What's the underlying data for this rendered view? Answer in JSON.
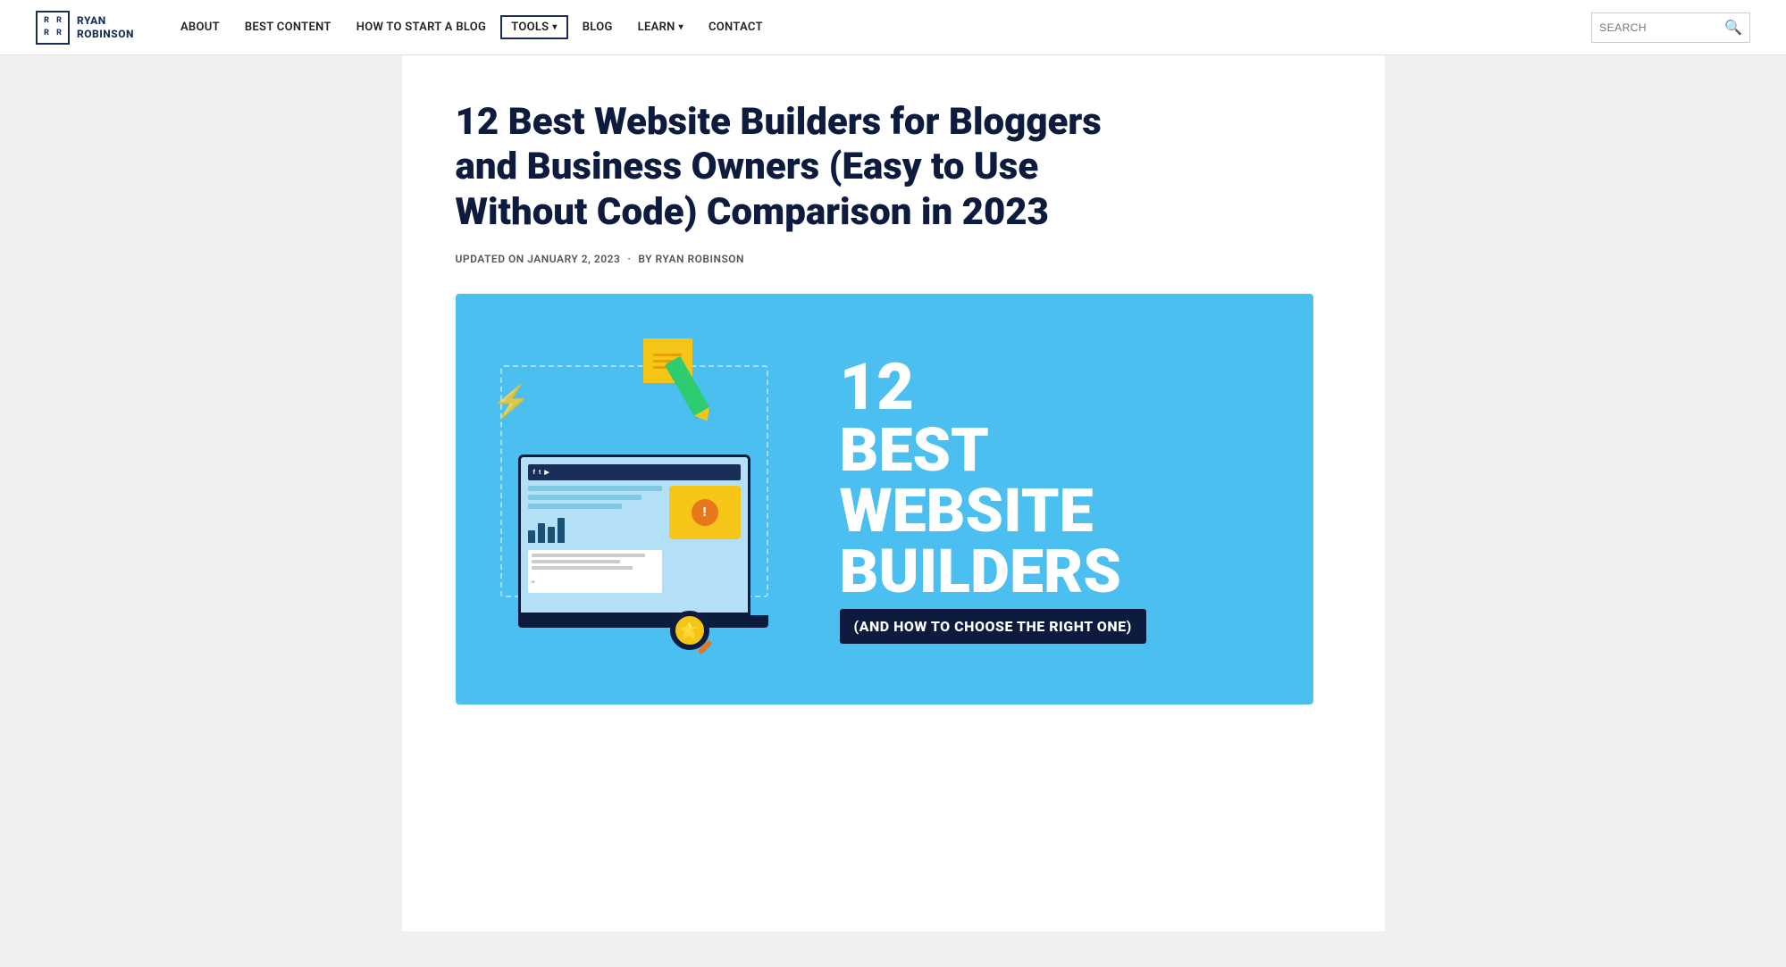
{
  "logo": {
    "line1": "RYAN",
    "line2": "ROBINSON",
    "letters": [
      "R",
      "R",
      "R",
      "R"
    ]
  },
  "nav": {
    "items": [
      {
        "id": "about",
        "label": "ABOUT",
        "active": false,
        "hasDropdown": false
      },
      {
        "id": "best-content",
        "label": "BEST CONTENT",
        "active": false,
        "hasDropdown": false
      },
      {
        "id": "how-to-start-a-blog",
        "label": "HOW TO START A BLOG",
        "active": false,
        "hasDropdown": false
      },
      {
        "id": "tools",
        "label": "TOOLS",
        "active": true,
        "hasDropdown": true
      },
      {
        "id": "blog",
        "label": "BLOG",
        "active": false,
        "hasDropdown": false
      },
      {
        "id": "learn",
        "label": "LEARN",
        "active": false,
        "hasDropdown": true
      },
      {
        "id": "contact",
        "label": "CONTACT",
        "active": false,
        "hasDropdown": false
      }
    ],
    "search_placeholder": "SEARCH"
  },
  "article": {
    "title": "12 Best Website Builders for Bloggers and Business Owners (Easy to Use Without Code) Comparison in 2023",
    "meta": {
      "updated_label": "UPDATED ON JANUARY 2, 2023",
      "separator": "·",
      "by_label": "BY RYAN ROBINSON"
    }
  },
  "hero_image": {
    "number": "12",
    "word1": "BEST",
    "word2": "WEBSITE",
    "word3": "BUILDERS",
    "tagline": "(AND HOW TO CHOOSE THE RIGHT ONE)",
    "bg_color": "#4bbfef"
  }
}
